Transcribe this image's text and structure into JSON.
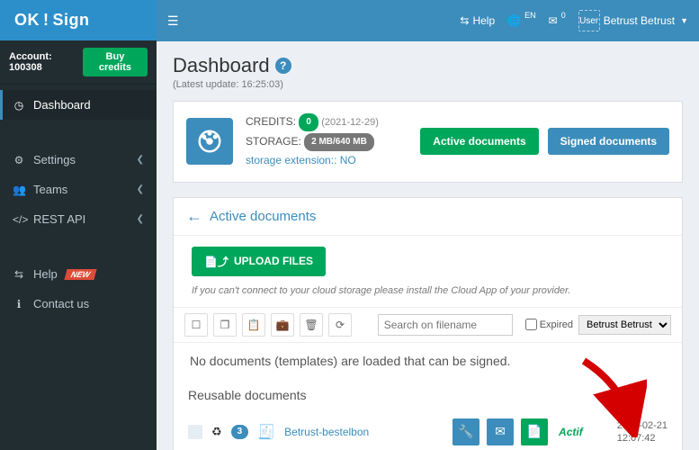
{
  "brand": {
    "part1": "OK",
    "bang": "!",
    "part2": "Sign"
  },
  "account": {
    "label": "Account: 100308",
    "buy_credits": "Buy credits"
  },
  "nav": {
    "dashboard": "Dashboard",
    "settings": "Settings",
    "teams": "Teams",
    "rest_api": "REST API",
    "help": "Help",
    "help_badge": "NEW",
    "contact": "Contact us"
  },
  "topbar": {
    "help": "Help",
    "lang": "EN",
    "user_alt": "User",
    "username": "Betrust Betrust"
  },
  "page": {
    "title": "Dashboard",
    "latest_update": "(Latest update: 16:25:03)"
  },
  "credits": {
    "label": "CREDITS:",
    "count": "0",
    "expiry": "(2021-12-29)",
    "storage_label": "STORAGE:",
    "storage_value": "2 MB/640 MB",
    "ext_label": "storage extension::",
    "ext_value": "NO"
  },
  "tabs": {
    "active": "Active documents",
    "signed": "Signed documents"
  },
  "active_panel": {
    "title": "Active documents",
    "upload": "UPLOAD FILES",
    "hint": "If you can't connect to your cloud storage please install the Cloud App of your provider."
  },
  "filters": {
    "search_placeholder": "Search on filename",
    "expired_label": "Expired",
    "user_options": [
      "Betrust Betrust"
    ]
  },
  "empty_message": "No documents (templates) are loaded that can be signed.",
  "reusable": {
    "title": "Reusable documents",
    "doc": {
      "count": "3",
      "name": "Betrust-bestelbon",
      "state": "Actif",
      "date": "2022-02-21",
      "time": "12:07:42"
    }
  }
}
